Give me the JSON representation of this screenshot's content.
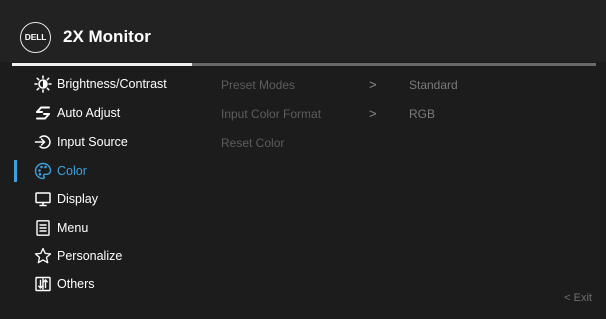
{
  "header": {
    "logo_text": "DELL",
    "title": "2X Monitor"
  },
  "menu": {
    "items": [
      {
        "label": "Brightness/Contrast",
        "icon": "brightness-icon"
      },
      {
        "label": "Auto Adjust",
        "icon": "auto-adjust-icon"
      },
      {
        "label": "Input Source",
        "icon": "input-source-icon"
      },
      {
        "label": "Color",
        "icon": "color-palette-icon",
        "selected": true
      },
      {
        "label": "Display",
        "icon": "display-icon"
      },
      {
        "label": "Menu",
        "icon": "menu-icon"
      },
      {
        "label": "Personalize",
        "icon": "star-icon"
      },
      {
        "label": "Others",
        "icon": "others-icon"
      }
    ]
  },
  "submenu": {
    "items": [
      {
        "label": "Preset Modes",
        "arrow": ">",
        "value": "Standard"
      },
      {
        "label": "Input Color Format",
        "arrow": ">",
        "value": "RGB"
      },
      {
        "label": "Reset Color"
      }
    ]
  },
  "footer": {
    "exit_label": "< Exit"
  },
  "colors": {
    "background": "#1c1c1c",
    "accent": "#3ea1de",
    "disabled_text": "#5d5d5d"
  }
}
